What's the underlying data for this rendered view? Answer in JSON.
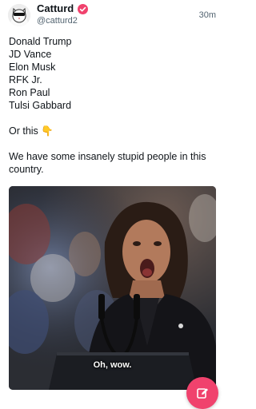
{
  "post": {
    "author_name": "Catturd",
    "author_handle": "@catturd2",
    "time": "30m",
    "text": "Donald Trump\nJD Vance\nElon Musk\nRFK Jr.\nRon Paul\nTulsi Gabbard\n\nOr this 👇\n\nWe have some insanely stupid people in this country.",
    "media_caption": "Oh, wow."
  },
  "colors": {
    "verified_badge": "#f0426d",
    "compose_button": "#f0426d",
    "secondary_text": "#536471"
  },
  "icons": {
    "verified": "verified-badge-icon",
    "compose": "compose-pencil-icon",
    "avatar": "cat-avatar"
  }
}
